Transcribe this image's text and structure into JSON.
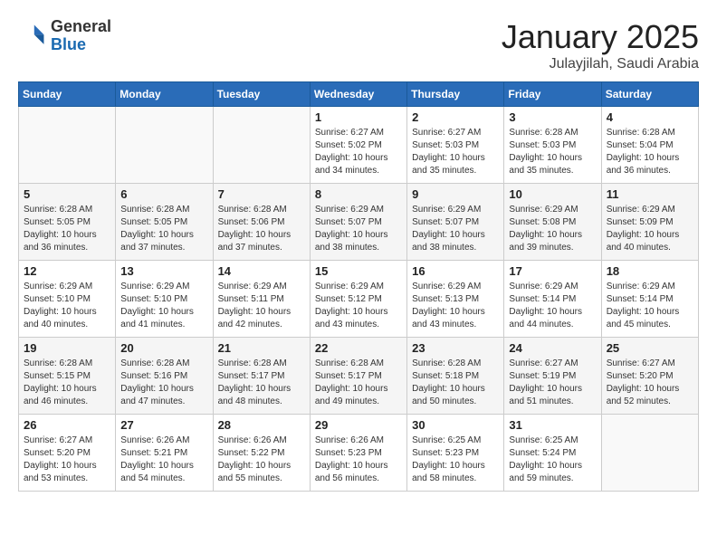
{
  "header": {
    "logo_general": "General",
    "logo_blue": "Blue",
    "month_year": "January 2025",
    "location": "Julayjilah, Saudi Arabia"
  },
  "days_of_week": [
    "Sunday",
    "Monday",
    "Tuesday",
    "Wednesday",
    "Thursday",
    "Friday",
    "Saturday"
  ],
  "weeks": [
    [
      {
        "day": "",
        "info": ""
      },
      {
        "day": "",
        "info": ""
      },
      {
        "day": "",
        "info": ""
      },
      {
        "day": "1",
        "info": "Sunrise: 6:27 AM\nSunset: 5:02 PM\nDaylight: 10 hours\nand 34 minutes."
      },
      {
        "day": "2",
        "info": "Sunrise: 6:27 AM\nSunset: 5:03 PM\nDaylight: 10 hours\nand 35 minutes."
      },
      {
        "day": "3",
        "info": "Sunrise: 6:28 AM\nSunset: 5:03 PM\nDaylight: 10 hours\nand 35 minutes."
      },
      {
        "day": "4",
        "info": "Sunrise: 6:28 AM\nSunset: 5:04 PM\nDaylight: 10 hours\nand 36 minutes."
      }
    ],
    [
      {
        "day": "5",
        "info": "Sunrise: 6:28 AM\nSunset: 5:05 PM\nDaylight: 10 hours\nand 36 minutes."
      },
      {
        "day": "6",
        "info": "Sunrise: 6:28 AM\nSunset: 5:05 PM\nDaylight: 10 hours\nand 37 minutes."
      },
      {
        "day": "7",
        "info": "Sunrise: 6:28 AM\nSunset: 5:06 PM\nDaylight: 10 hours\nand 37 minutes."
      },
      {
        "day": "8",
        "info": "Sunrise: 6:29 AM\nSunset: 5:07 PM\nDaylight: 10 hours\nand 38 minutes."
      },
      {
        "day": "9",
        "info": "Sunrise: 6:29 AM\nSunset: 5:07 PM\nDaylight: 10 hours\nand 38 minutes."
      },
      {
        "day": "10",
        "info": "Sunrise: 6:29 AM\nSunset: 5:08 PM\nDaylight: 10 hours\nand 39 minutes."
      },
      {
        "day": "11",
        "info": "Sunrise: 6:29 AM\nSunset: 5:09 PM\nDaylight: 10 hours\nand 40 minutes."
      }
    ],
    [
      {
        "day": "12",
        "info": "Sunrise: 6:29 AM\nSunset: 5:10 PM\nDaylight: 10 hours\nand 40 minutes."
      },
      {
        "day": "13",
        "info": "Sunrise: 6:29 AM\nSunset: 5:10 PM\nDaylight: 10 hours\nand 41 minutes."
      },
      {
        "day": "14",
        "info": "Sunrise: 6:29 AM\nSunset: 5:11 PM\nDaylight: 10 hours\nand 42 minutes."
      },
      {
        "day": "15",
        "info": "Sunrise: 6:29 AM\nSunset: 5:12 PM\nDaylight: 10 hours\nand 43 minutes."
      },
      {
        "day": "16",
        "info": "Sunrise: 6:29 AM\nSunset: 5:13 PM\nDaylight: 10 hours\nand 43 minutes."
      },
      {
        "day": "17",
        "info": "Sunrise: 6:29 AM\nSunset: 5:14 PM\nDaylight: 10 hours\nand 44 minutes."
      },
      {
        "day": "18",
        "info": "Sunrise: 6:29 AM\nSunset: 5:14 PM\nDaylight: 10 hours\nand 45 minutes."
      }
    ],
    [
      {
        "day": "19",
        "info": "Sunrise: 6:28 AM\nSunset: 5:15 PM\nDaylight: 10 hours\nand 46 minutes."
      },
      {
        "day": "20",
        "info": "Sunrise: 6:28 AM\nSunset: 5:16 PM\nDaylight: 10 hours\nand 47 minutes."
      },
      {
        "day": "21",
        "info": "Sunrise: 6:28 AM\nSunset: 5:17 PM\nDaylight: 10 hours\nand 48 minutes."
      },
      {
        "day": "22",
        "info": "Sunrise: 6:28 AM\nSunset: 5:17 PM\nDaylight: 10 hours\nand 49 minutes."
      },
      {
        "day": "23",
        "info": "Sunrise: 6:28 AM\nSunset: 5:18 PM\nDaylight: 10 hours\nand 50 minutes."
      },
      {
        "day": "24",
        "info": "Sunrise: 6:27 AM\nSunset: 5:19 PM\nDaylight: 10 hours\nand 51 minutes."
      },
      {
        "day": "25",
        "info": "Sunrise: 6:27 AM\nSunset: 5:20 PM\nDaylight: 10 hours\nand 52 minutes."
      }
    ],
    [
      {
        "day": "26",
        "info": "Sunrise: 6:27 AM\nSunset: 5:20 PM\nDaylight: 10 hours\nand 53 minutes."
      },
      {
        "day": "27",
        "info": "Sunrise: 6:26 AM\nSunset: 5:21 PM\nDaylight: 10 hours\nand 54 minutes."
      },
      {
        "day": "28",
        "info": "Sunrise: 6:26 AM\nSunset: 5:22 PM\nDaylight: 10 hours\nand 55 minutes."
      },
      {
        "day": "29",
        "info": "Sunrise: 6:26 AM\nSunset: 5:23 PM\nDaylight: 10 hours\nand 56 minutes."
      },
      {
        "day": "30",
        "info": "Sunrise: 6:25 AM\nSunset: 5:23 PM\nDaylight: 10 hours\nand 58 minutes."
      },
      {
        "day": "31",
        "info": "Sunrise: 6:25 AM\nSunset: 5:24 PM\nDaylight: 10 hours\nand 59 minutes."
      },
      {
        "day": "",
        "info": ""
      }
    ]
  ]
}
